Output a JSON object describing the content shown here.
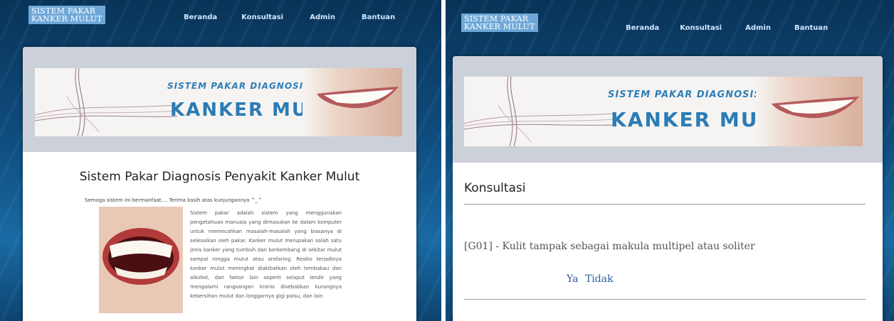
{
  "left": {
    "logo": {
      "line1": "SISTEM PAKAR",
      "line2": "KANKER MULUT"
    },
    "nav": [
      "Beranda",
      "Konsultasi",
      "Admin",
      "Bantuan"
    ],
    "banner": {
      "line1": "SISTEM PAKAR DIAGNOSIS",
      "line2": "KANKER MULUT"
    },
    "page_title": "Sistem Pakar Diagnosis Penyakit Kanker Mulut",
    "tagline": "Semoga sistem ini bermanfaat.... Terima kasih atas kunjungannya ^_^",
    "paragraph": "Sistem pakar adalah sistem yang menggunakan pengetahuan manusia yang dimasukan ke dalam komputer untuk memecahkan masalah-masalah yang biasanya di selesaikan oleh pakar. Kanker mulut merupakan salah satu jenis kanker yang tumbuh dan berkembang di sekitar mulut sampai rongga mulut atau orofaring. Resiko terjadinya kanker mulut meningkat diakibatkan oleh tembakau dan alkohol, dan faktor lain seperti selaput lendir yang mengalami rangsangan kronis disebabkan kurangnya kebersihan mulut dan longgarnya gigi palsu, dan lain"
  },
  "right": {
    "logo": {
      "line1": "SISTEM PAKAR",
      "line2": "KANKER MULUT"
    },
    "nav": [
      "Beranda",
      "Konsultasi",
      "Admin",
      "Bantuan"
    ],
    "banner": {
      "line1": "SISTEM PAKAR DIAGNOSIS",
      "line2": "KANKER MULUT"
    },
    "heading": "Konsultasi",
    "question": "[G01] - Kulit tampak sebagai makula multipel atau soliter",
    "answer_yes": "Ya",
    "answer_no": "Tidak"
  }
}
